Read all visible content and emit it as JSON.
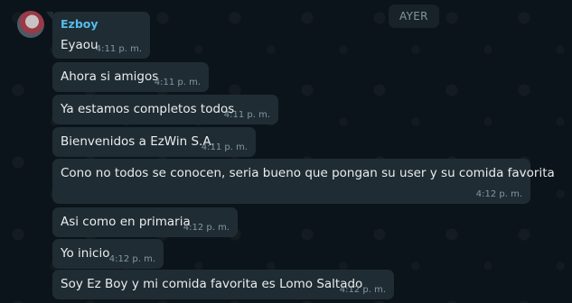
{
  "day_separator": "AYER",
  "group_sender": "Ezboy",
  "messages": [
    {
      "text": "Eyaou",
      "time": "4:11 p. m."
    },
    {
      "text": "Ahora si amigos",
      "time": "4:11 p. m."
    },
    {
      "text": "Ya estamos completos todos",
      "time": "4:11 p. m."
    },
    {
      "text": "Bienvenidos a EzWin S.A.",
      "time": "4:11 p. m."
    },
    {
      "text": "Cono no todos se conocen, seria bueno que pongan su user y su comida favorita",
      "time": "4:12 p. m."
    },
    {
      "text": "Asi como en primaria",
      "time": "4:12 p. m."
    },
    {
      "text": "Yo inicio",
      "time": "4:12 p. m."
    },
    {
      "text": "Soy Ez Boy y mi comida favorita es Lomo Saltado",
      "time": "4:12 p. m."
    }
  ]
}
